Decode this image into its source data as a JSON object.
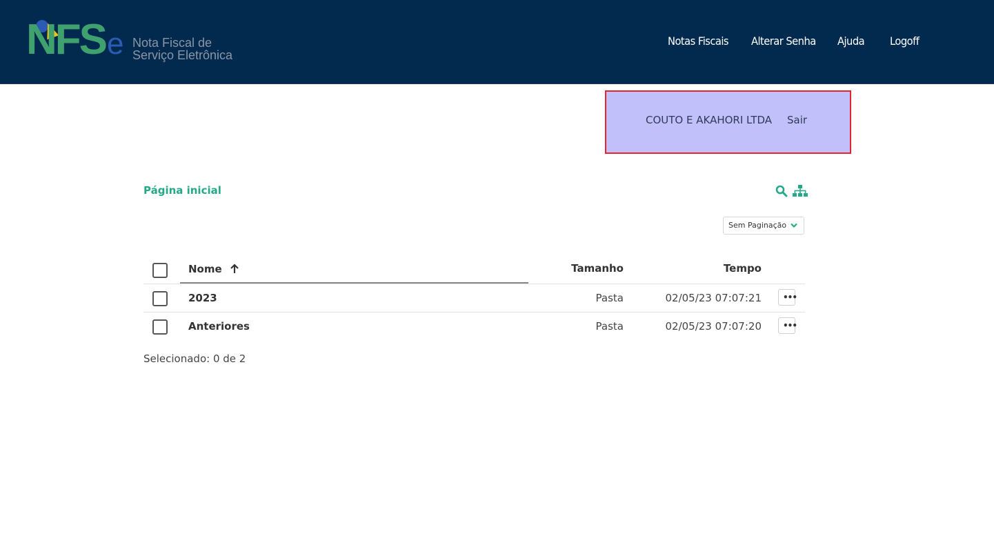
{
  "header": {
    "logo": {
      "mark": [
        "N",
        "F",
        "S",
        "e"
      ],
      "text_line1": "Nota Fiscal de",
      "text_line2": "Serviço Eletrônica"
    },
    "nav": [
      "Notas Fiscais",
      "Alterar Senha",
      "Ajuda",
      "Logoff"
    ],
    "colors": {
      "background": "#022a4e",
      "logo_green": "#3fa26e",
      "logo_blue": "#2c5bb5",
      "logo_yellow": "#f2c218"
    }
  },
  "user_box": {
    "company": "COUTO E AKAHORI LTDA",
    "exit": "Sair",
    "background": "#c2c0fb",
    "border": "#e1262d"
  },
  "breadcrumb": {
    "home": "Página inicial",
    "color": "#26a88a"
  },
  "toolbar": {
    "icons": [
      "search-icon",
      "sitemap-icon"
    ]
  },
  "pagination": {
    "selected": "Sem Paginação"
  },
  "table": {
    "columns": {
      "name": "Nome",
      "size": "Tamanho",
      "time": "Tempo"
    },
    "sort_indicator": "↑",
    "rows": [
      {
        "name": "2023",
        "size": "Pasta",
        "time": "02/05/23 07:07:21",
        "more": "•••"
      },
      {
        "name": "Anteriores",
        "size": "Pasta",
        "time": "02/05/23 07:07:20",
        "more": "•••"
      }
    ]
  },
  "status": {
    "selected": "Selecionado: 0 de 2"
  }
}
